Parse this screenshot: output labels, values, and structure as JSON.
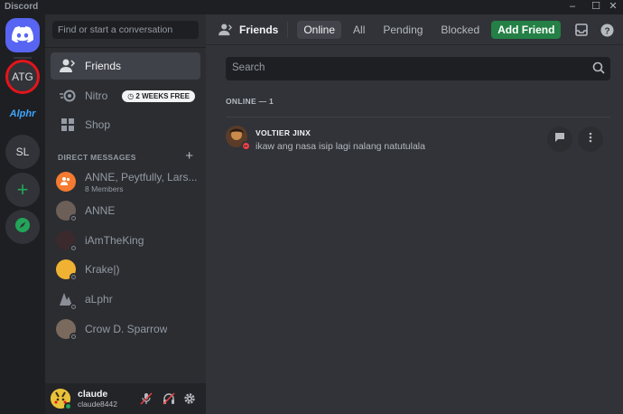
{
  "window": {
    "title": "Discord",
    "minimize": "–",
    "maximize": "☐",
    "close": "✕"
  },
  "servers": [
    {
      "label": "",
      "icon": "discord-logo-icon"
    },
    {
      "label": "ATG"
    },
    {
      "label": "Alphr"
    },
    {
      "label": "SL"
    },
    {
      "label": "+",
      "icon": "add-server-icon"
    },
    {
      "label": "",
      "icon": "compass-icon"
    }
  ],
  "sidebar": {
    "search_placeholder": "Find or start a conversation",
    "nav": [
      {
        "label": "Friends",
        "icon": "friends-icon"
      },
      {
        "label": "Nitro",
        "icon": "nitro-icon",
        "badge": "2 WEEKS FREE"
      },
      {
        "label": "Shop",
        "icon": "shop-icon"
      }
    ],
    "dm_header": "DIRECT MESSAGES",
    "dm_add": "+",
    "dms": [
      {
        "name": "ANNE, Peytfully, Lars...",
        "sub": "8 Members",
        "color": "#f47b30"
      },
      {
        "name": "ANNE",
        "color": "#6b5f58"
      },
      {
        "name": "iAmTheKing",
        "color": "#3a2a2e"
      },
      {
        "name": "Krake|)",
        "color": "#f0b232"
      },
      {
        "name": "aLphr",
        "color": "#8b8e96"
      },
      {
        "name": "Crow D. Sparrow",
        "color": "#7a6a5e"
      }
    ]
  },
  "user": {
    "name": "claude",
    "tag": "claude8442"
  },
  "topbar": {
    "title": "Friends",
    "tabs": [
      "Online",
      "All",
      "Pending",
      "Blocked"
    ],
    "add_friend": "Add Friend"
  },
  "main": {
    "search_placeholder": "Search",
    "online_header": "ONLINE — 1",
    "friends": [
      {
        "name": "VOLTIER JINX",
        "status": "ikaw ang nasa isip lagi nalang natutulala",
        "presence": "dnd"
      }
    ]
  },
  "colors": {
    "accent": "#5865f2",
    "add_friend": "#248046",
    "online": "#23a559",
    "dnd": "#f23f43",
    "highlight_ring": "#e5141b"
  }
}
